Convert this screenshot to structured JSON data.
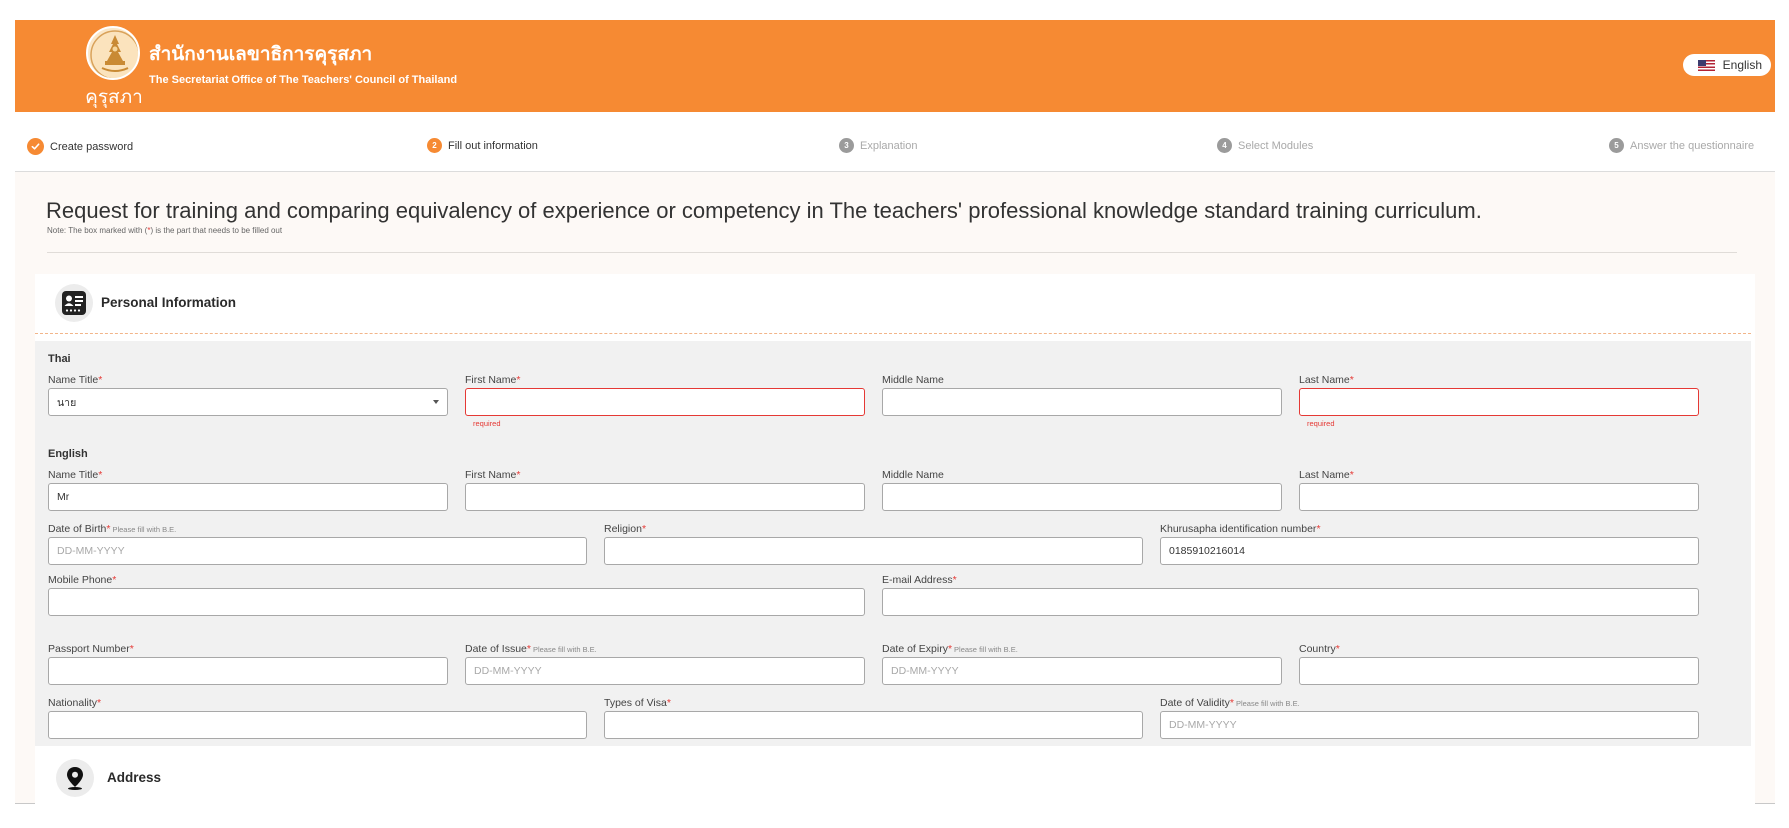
{
  "header": {
    "seal_label": "คุรุสภา",
    "org_name_th": "สำนักงานเลขาธิการคุรุสภา",
    "org_name_en": "The Secretariat Office of The Teachers' Council of Thailand",
    "language": "English",
    "brand_color": "#f68a33"
  },
  "stepper": {
    "steps": [
      {
        "number": "1",
        "label": "Create password",
        "state": "done"
      },
      {
        "number": "2",
        "label": "Fill out information",
        "state": "active"
      },
      {
        "number": "3",
        "label": "Explanation",
        "state": "todo"
      },
      {
        "number": "4",
        "label": "Select Modules",
        "state": "todo"
      },
      {
        "number": "5",
        "label": "Answer the questionnaire",
        "state": "todo"
      }
    ]
  },
  "page": {
    "title": "Request for training and comparing equivalency of experience or competency in The teachers' professional knowledge standard training curriculum.",
    "note_prefix": "Note: The box marked with (",
    "note_star": "*",
    "note_suffix": ") is the part that needs to be filled out"
  },
  "personal": {
    "section_title": "Personal Information",
    "thai_label": "Thai",
    "english_label": "English",
    "required_star": "*",
    "be_hint": "Please fill with B.E.",
    "date_placeholder": "DD-MM-YYYY",
    "required_msg": "required",
    "labels": {
      "name_title": "Name Title",
      "first_name": "First Name",
      "middle_name": "Middle Name",
      "last_name": "Last Name",
      "date_of_birth": "Date of Birth",
      "religion": "Religion",
      "khurusapha_id": "Khurusapha identification number",
      "mobile_phone": "Mobile Phone",
      "email": "E-mail Address",
      "passport_number": "Passport Number",
      "date_of_issue": "Date of Issue",
      "date_of_expiry": "Date of Expiry",
      "country": "Country",
      "nationality": "Nationality",
      "visa_type": "Types of Visa",
      "date_of_validity": "Date of Validity"
    },
    "values": {
      "thai_name_title": "นาย",
      "en_name_title": "Mr",
      "khurusapha_id": "0185910216014"
    }
  },
  "address": {
    "section_title": "Address"
  }
}
